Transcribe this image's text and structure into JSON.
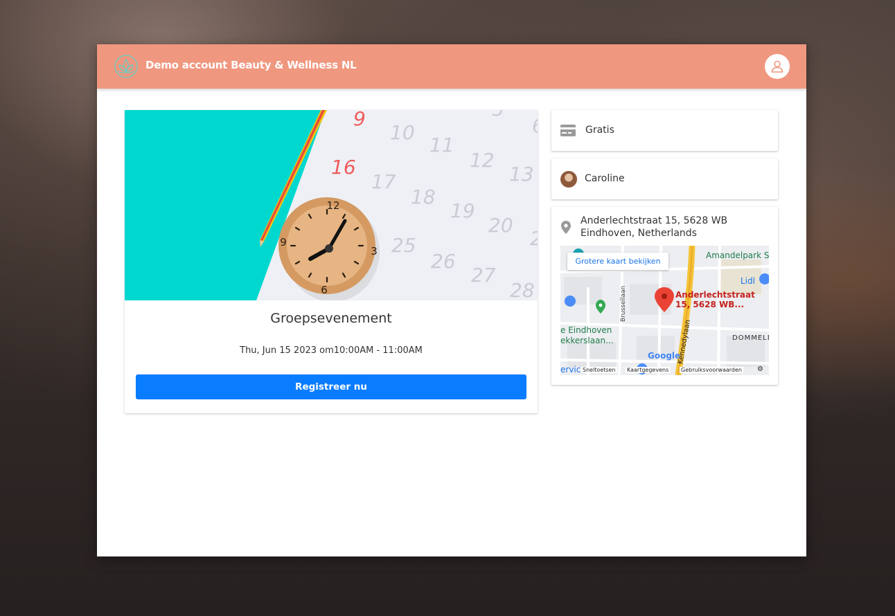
{
  "header": {
    "brand": "Demo account Beauty & Wellness NL",
    "logo_icon": "lotus-logo-icon",
    "user_icon": "user-icon",
    "color": "#f0977f"
  },
  "event": {
    "title": "Groepsevenement",
    "datetime": "Thu, Jun 15 2023 om10:00AM - 11:00AM",
    "register_label": "Registreer nu",
    "calendar_numbers": [
      "9",
      "10",
      "11",
      "12",
      "13",
      "16",
      "17",
      "18",
      "19",
      "20",
      "25",
      "26",
      "27",
      "28",
      "5",
      "6",
      "2"
    ],
    "clock_numbers": [
      "12",
      "3",
      "6",
      "9"
    ]
  },
  "sidebar": {
    "price": "Gratis",
    "price_icon": "credit-card-icon",
    "staff": "Caroline",
    "location_icon": "map-pin-icon",
    "address_line1": "Anderlechtstraat 15, 5628 WB",
    "address_line2": "Eindhoven, Netherlands"
  },
  "map": {
    "larger_map_link": "Grotere kaart bekijken",
    "pin_label_line1": "Anderlechtstraat",
    "pin_label_line2": "15, 5628 WB...",
    "places": [
      "Amandelpark S",
      "Lidl",
      "e Eindhoven",
      "ekkerslaan...",
      "ervic"
    ],
    "streets": [
      "Brussellaan",
      "Kennedylaan",
      "DOMMELE"
    ],
    "google": "Google",
    "footer": [
      "Sneltoetsen",
      "Kaartgegevens",
      "Gebruiksvoorwaarden"
    ]
  },
  "colors": {
    "accent": "#0a7cff",
    "header": "#f0977f",
    "teal": "#00d8cf"
  }
}
